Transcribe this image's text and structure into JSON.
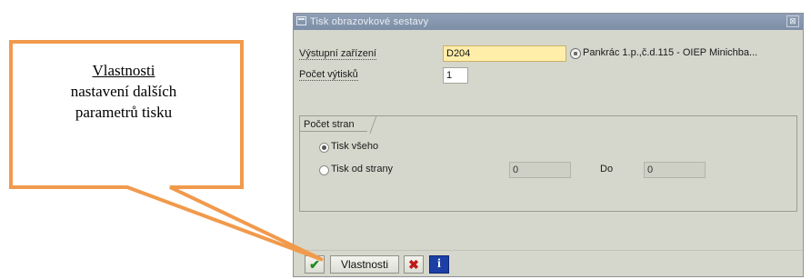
{
  "callout": {
    "title": "Vlastnosti",
    "line1": "nastavení dalších",
    "line2": "parametrů tisku"
  },
  "dialog": {
    "title": "Tisk obrazovkové sestavy",
    "close_glyph": "⊠",
    "output_device_label": "Výstupní zařízení",
    "output_device_value": "D204",
    "output_device_description": "Pankrác 1.p.,č.d.115 - OIEP Minichba...",
    "copies_label": "Počet výtisků",
    "copies_value": "1",
    "pages_group_title": "Počet stran",
    "print_all_label": "Tisk všeho",
    "print_from_label": "Tisk od strany",
    "from_page_value": "0",
    "to_label": "Do",
    "to_page_value": "0"
  },
  "footer": {
    "ok_glyph": "✔",
    "properties_label": "Vlastnosti",
    "cancel_glyph": "✖",
    "info_glyph": "i"
  },
  "colors": {
    "callout_border": "#f19a4c",
    "required_field": "#ffeeaa",
    "titlebar": "#8797ae"
  }
}
